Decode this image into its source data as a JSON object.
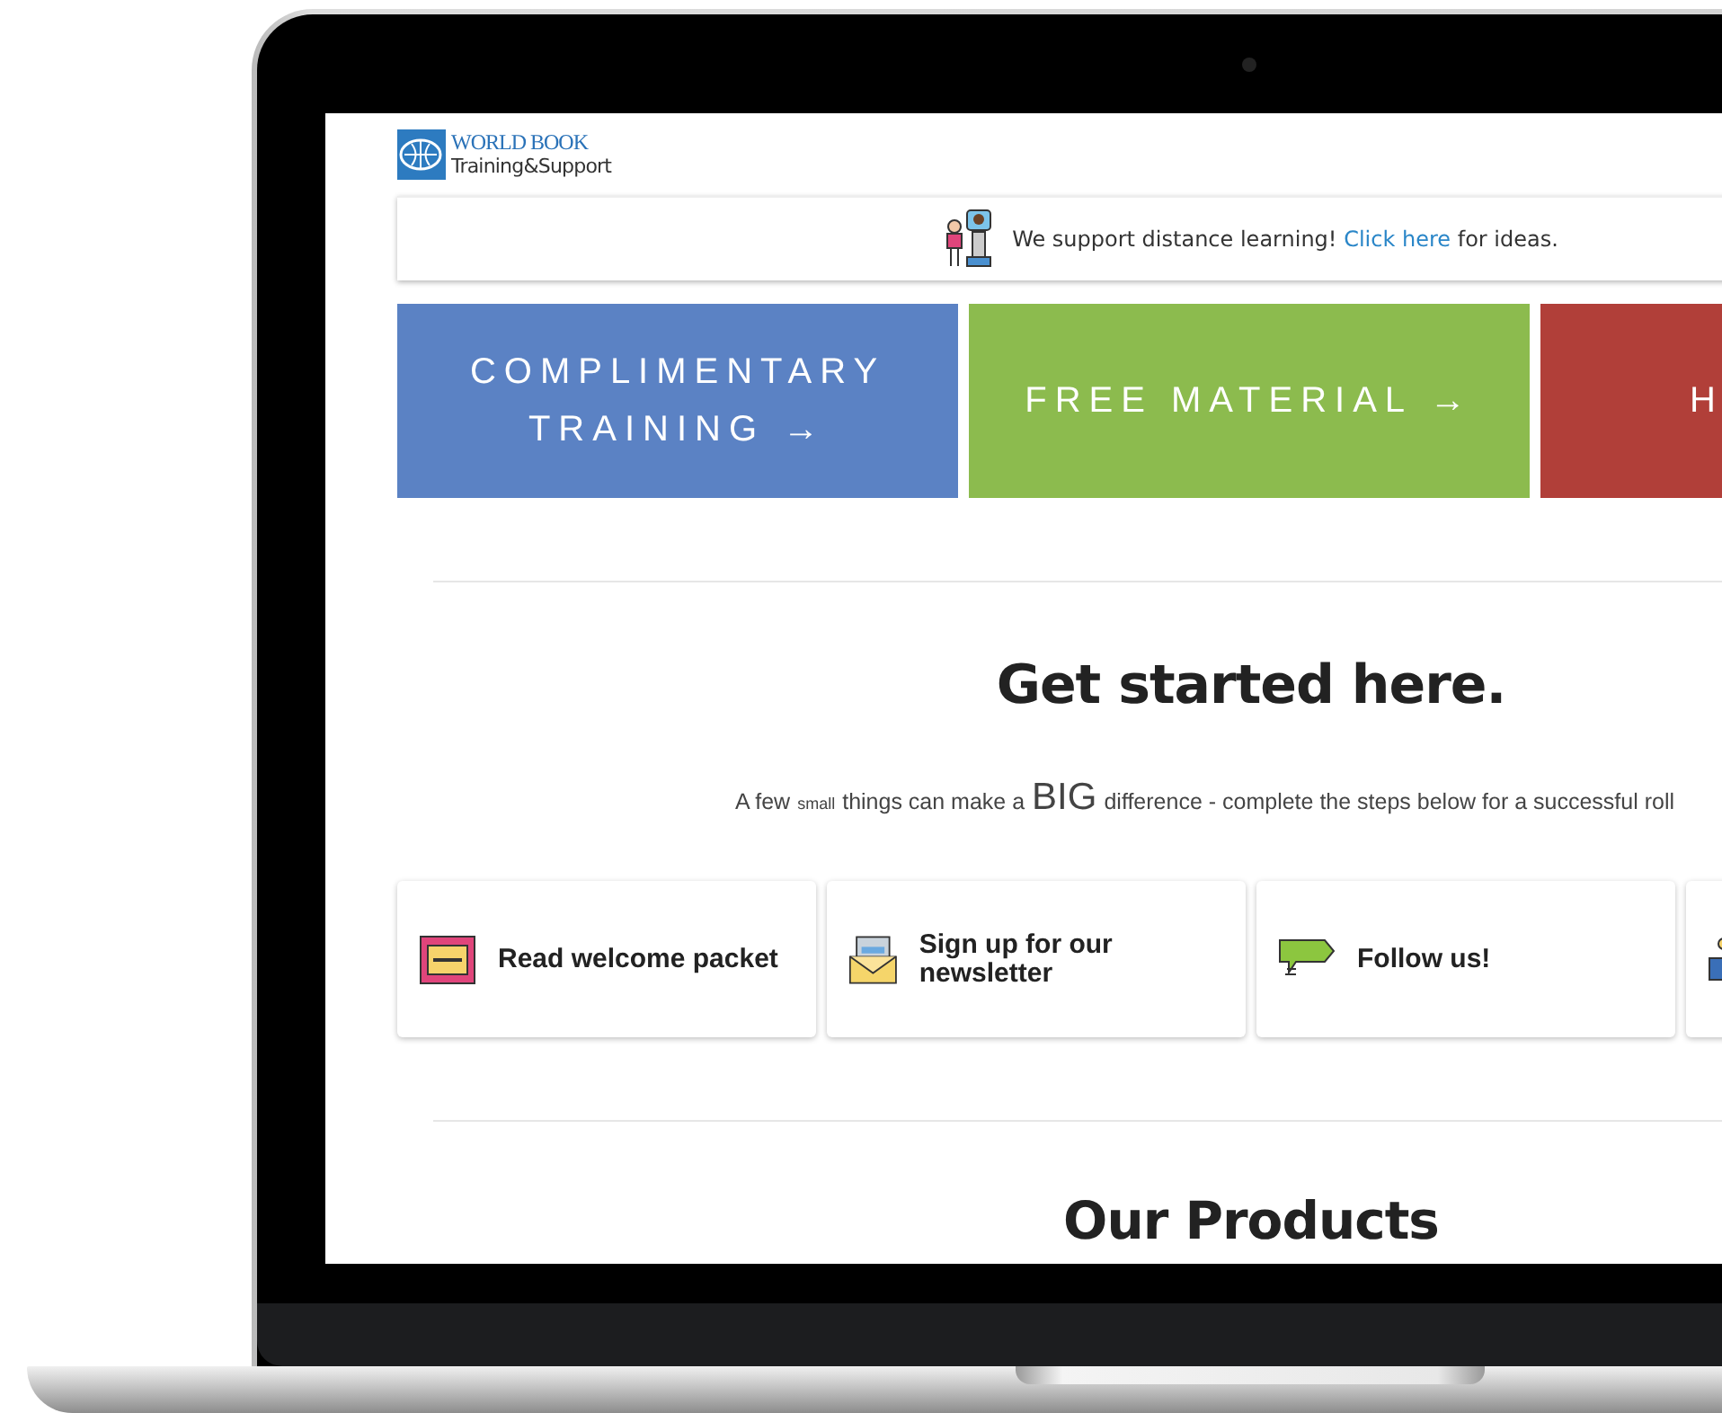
{
  "logo": {
    "line_1": "WORLD BOOK",
    "line_2": "Training&Support"
  },
  "notice": {
    "text_before": "We support distance learning!",
    "link": "Click here",
    "text_after": "for ideas."
  },
  "tiles": [
    {
      "label": "COMPLIMENTARY TRAINING →",
      "color": "#5b82c4",
      "kind": "full"
    },
    {
      "label": "FREE MATERIAL →",
      "color": "#8cbb4e",
      "kind": "full"
    },
    {
      "label": "H",
      "color": "#b13f39",
      "kind": "cut"
    }
  ],
  "heading": "Get started here.",
  "subtitle": [
    {
      "text": "A few",
      "kind": "normal"
    },
    {
      "text": "small",
      "kind": "small"
    },
    {
      "text": "things can make a",
      "kind": "normal"
    },
    {
      "text": "BIG",
      "kind": "big"
    },
    {
      "text": "difference - complete the steps below for a successful roll",
      "kind": "normal"
    }
  ],
  "steps": [
    {
      "kind": "labelled",
      "label": "Read welcome packet"
    },
    {
      "kind": "labelled",
      "label": "Sign up for our newsletter"
    },
    {
      "kind": "labelled",
      "label": "Follow us!"
    },
    {
      "kind": "cut"
    }
  ],
  "products_heading": "Our Products"
}
